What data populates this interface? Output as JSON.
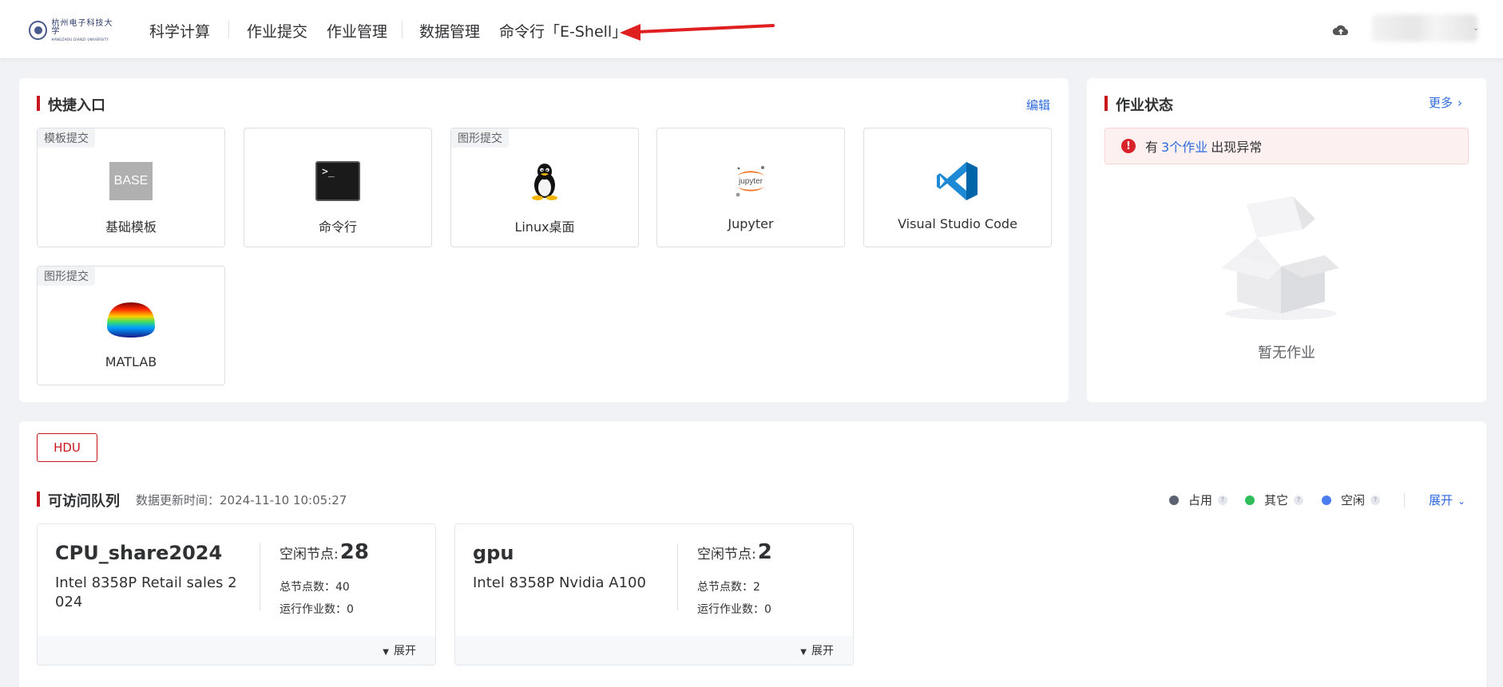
{
  "nav": {
    "logo": {
      "cn": "杭州电子科技大学",
      "en": "HANGZHOU DIANZI UNIVERSITY"
    },
    "items": [
      "科学计算",
      "作业提交",
      "作业管理",
      "数据管理",
      "命令行「E-Shell」"
    ]
  },
  "quick": {
    "title": "快捷入口",
    "edit": "编辑",
    "cards": [
      {
        "tag": "模板提交",
        "label": "基础模板",
        "icon": "base-template-icon",
        "icon_text": "BASE"
      },
      {
        "tag": "",
        "label": "命令行",
        "icon": "terminal-icon",
        "icon_text": ">_"
      },
      {
        "tag": "图形提交",
        "label": "Linux桌面",
        "icon": "linux-tux-icon"
      },
      {
        "tag": "",
        "label": "Jupyter",
        "icon": "jupyter-icon",
        "icon_text": "jupyter"
      },
      {
        "tag": "",
        "label": "Visual Studio Code",
        "icon": "vscode-icon"
      },
      {
        "tag": "图形提交",
        "label": "MATLAB",
        "icon": "matlab-icon"
      }
    ]
  },
  "status": {
    "title": "作业状态",
    "more": "更多",
    "alert": {
      "prefix": "有",
      "link": "3个作业",
      "suffix": "出现异常"
    },
    "empty": "暂无作业"
  },
  "queues": {
    "group_button": "HDU",
    "title": "可访问队列",
    "update_time": "数据更新时间：2024-11-10 10:05:27",
    "legend": [
      {
        "label": "占用",
        "color": "#5b6170"
      },
      {
        "label": "其它",
        "color": "#2ebd59"
      },
      {
        "label": "空闲",
        "color": "#4c7df0"
      }
    ],
    "expand_all": "展开",
    "cards": [
      {
        "name": "CPU_share2024",
        "desc": "Intel 8358P Retail sales 2024",
        "free_label": "空闲节点:",
        "free": "28",
        "total_label": "总节点数：",
        "total": "40",
        "running_label": "运行作业数：",
        "running": "0",
        "expand": "展开"
      },
      {
        "name": "gpu",
        "desc": "Intel 8358P Nvidia A100",
        "free_label": "空闲节点:",
        "free": "2",
        "total_label": "总节点数：",
        "total": "2",
        "running_label": "运行作业数：",
        "running": "0",
        "expand": "展开"
      }
    ]
  },
  "colors": {
    "brand_red": "#c8161e",
    "link_blue": "#2f6bde",
    "annotation_arrow": "#e02020"
  }
}
